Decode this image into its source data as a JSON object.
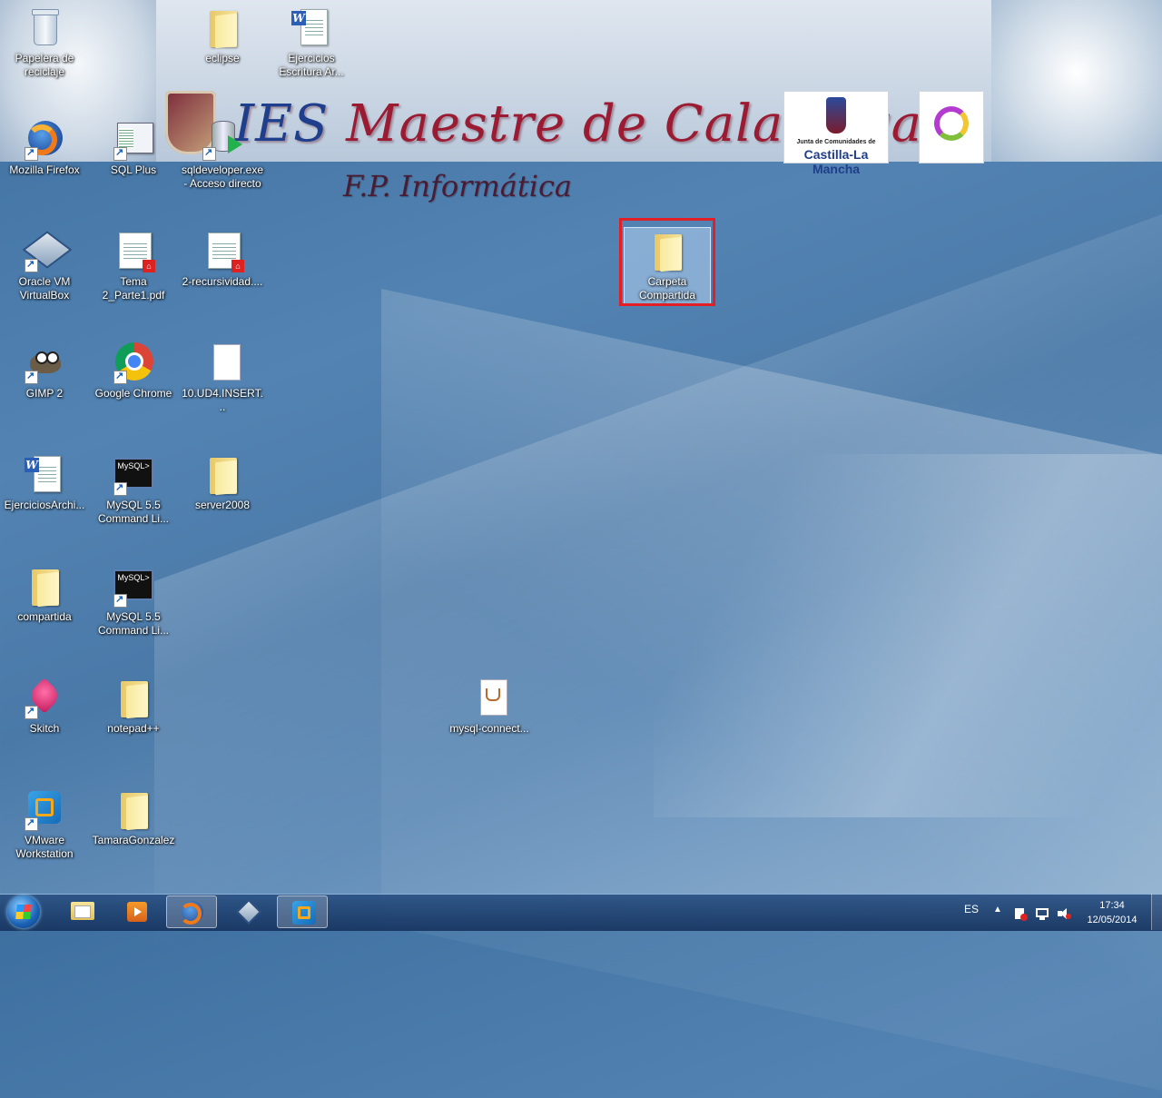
{
  "banner": {
    "title_prefix": "IES ",
    "title_rest": "Maestre de Calatrava",
    "subtitle": "F.P. Informática",
    "jccm_small": "Junta de Comunidades de",
    "jccm_big": "Castilla-La Mancha"
  },
  "icons": {
    "recycle_bin": {
      "line1": "Papelera de",
      "line2": "reciclaje"
    },
    "eclipse": {
      "line1": "eclipse"
    },
    "ejercicios_escritura": {
      "line1": "Ejercicios",
      "line2": "Escritura Ar..."
    },
    "firefox": {
      "line1": "Mozilla Firefox"
    },
    "sql_plus": {
      "line1": "SQL Plus"
    },
    "sqldeveloper": {
      "line1": "sqldeveloper.exe",
      "line2": "- Acceso directo"
    },
    "virtualbox": {
      "line1": "Oracle VM",
      "line2": "VirtualBox"
    },
    "tema2": {
      "line1": "Tema",
      "line2": "2_Parte1.pdf"
    },
    "recursividad": {
      "line1": "2-recursividad...."
    },
    "carpeta_compartida": {
      "line1": "Carpeta",
      "line2": "Compartida"
    },
    "gimp": {
      "line1": "GIMP 2"
    },
    "chrome": {
      "line1": "Google Chrome"
    },
    "insert": {
      "line1": "10.UD4.INSERT..."
    },
    "ejercicios_archi": {
      "line1": "EjerciciosArchi..."
    },
    "mysql1": {
      "line1": "MySQL 5.5",
      "line2": "Command Li...",
      "screen": "MySQL>"
    },
    "server2008": {
      "line1": "server2008"
    },
    "compartida": {
      "line1": "compartida"
    },
    "mysql2": {
      "line1": "MySQL 5.5",
      "line2": "Command Li...",
      "screen": "MySQL>"
    },
    "skitch": {
      "line1": "Skitch"
    },
    "notepadpp": {
      "line1": "notepad++"
    },
    "mysql_connector": {
      "line1": "mysql-connect..."
    },
    "vmware": {
      "line1": "VMware",
      "line2": "Workstation"
    },
    "tamara": {
      "line1": "TamaraGonzalez"
    }
  },
  "taskbar": {
    "language": "ES",
    "time": "17:34",
    "date": "12/05/2014",
    "buttons": [
      "windows-explorer",
      "media-player",
      "firefox",
      "virtualbox",
      "vmware"
    ]
  },
  "colors": {
    "selection_highlight": "#e31e24",
    "taskbar": "#1d4a80"
  }
}
